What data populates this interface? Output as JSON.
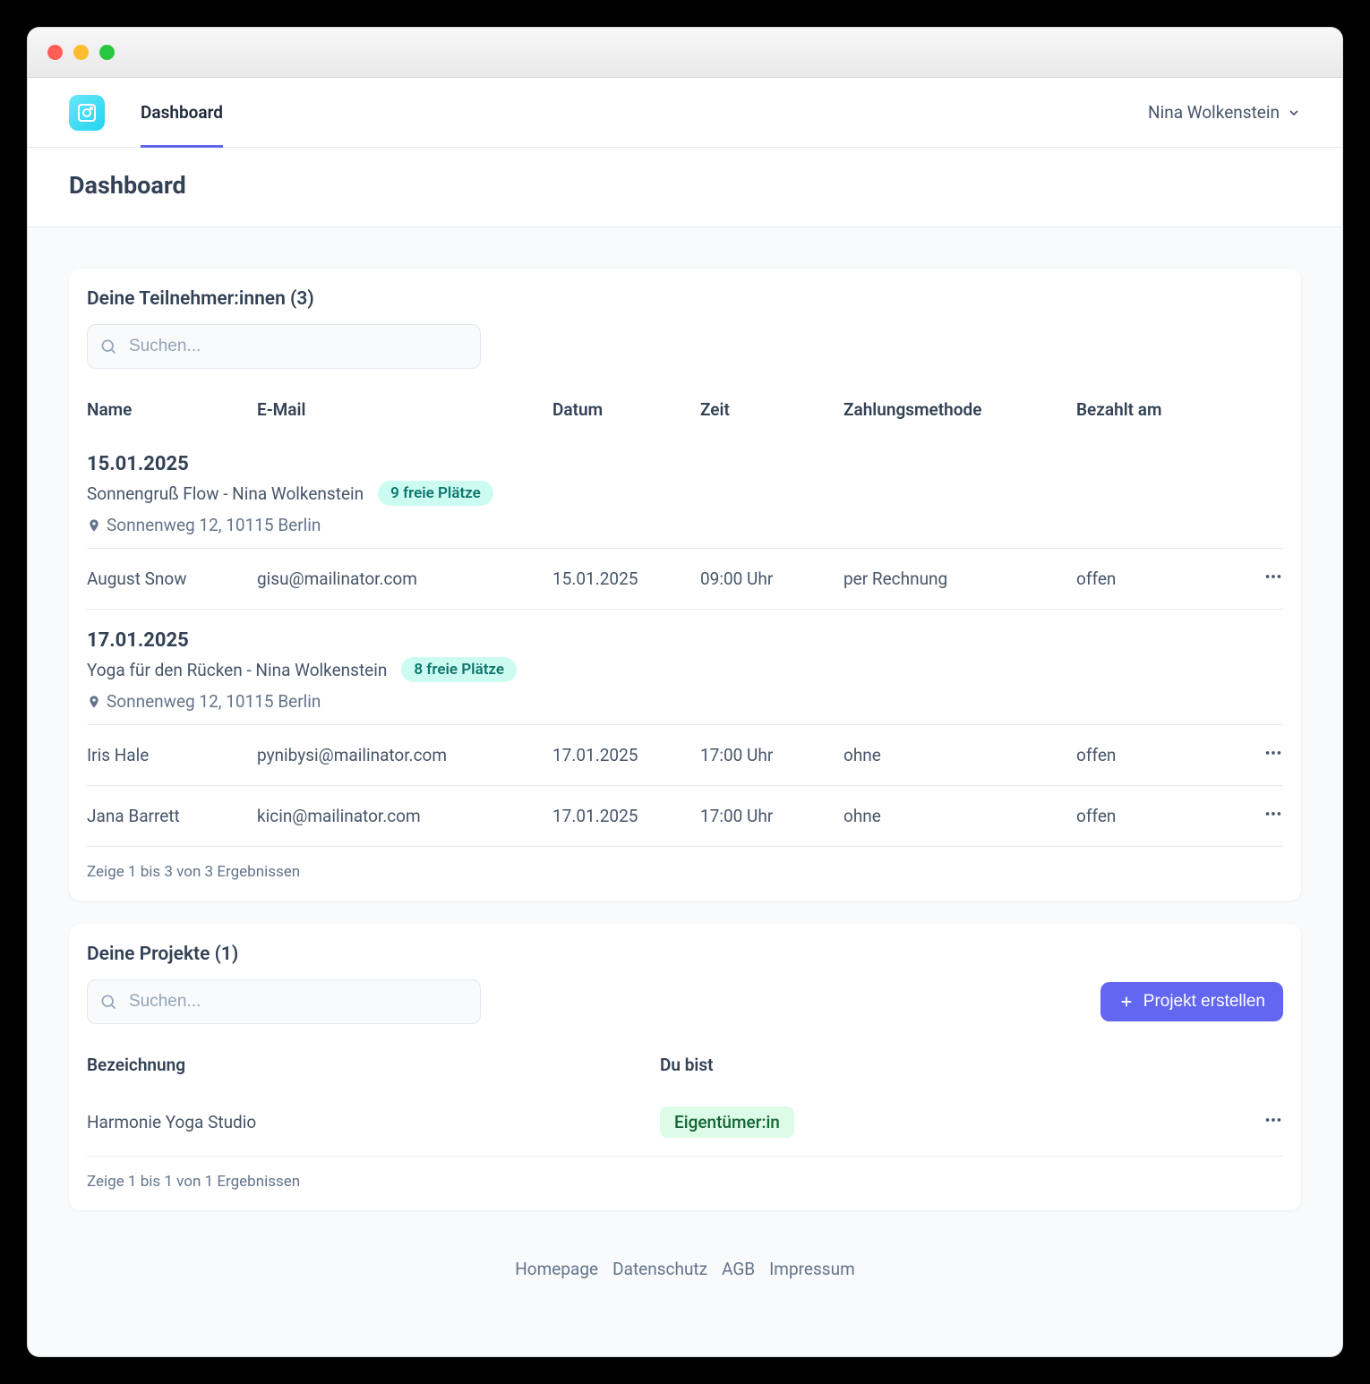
{
  "nav": {
    "tab": "Dashboard",
    "user": "Nina Wolkenstein"
  },
  "page_title": "Dashboard",
  "participants": {
    "title": "Deine Teilnehmer:innen (3)",
    "search_placeholder": "Suchen...",
    "columns": {
      "name": "Name",
      "email": "E-Mail",
      "date": "Datum",
      "time": "Zeit",
      "payment": "Zahlungsmethode",
      "paid_at": "Bezahlt am"
    },
    "groups": [
      {
        "date": "15.01.2025",
        "title": "Sonnengruß Flow - Nina Wolkenstein",
        "badge": "9 freie Plätze",
        "location": "Sonnenweg 12, 10115 Berlin",
        "rows": [
          {
            "name": "August Snow",
            "email": "gisu@mailinator.com",
            "date": "15.01.2025",
            "time": "09:00 Uhr",
            "payment": "per Rechnung",
            "paid_at": "offen"
          }
        ]
      },
      {
        "date": "17.01.2025",
        "title": "Yoga für den Rücken - Nina Wolkenstein",
        "badge": "8 freie Plätze",
        "location": "Sonnenweg 12, 10115 Berlin",
        "rows": [
          {
            "name": "Iris Hale",
            "email": "pynibysi@mailinator.com",
            "date": "17.01.2025",
            "time": "17:00 Uhr",
            "payment": "ohne",
            "paid_at": "offen"
          },
          {
            "name": "Jana Barrett",
            "email": "kicin@mailinator.com",
            "date": "17.01.2025",
            "time": "17:00 Uhr",
            "payment": "ohne",
            "paid_at": "offen"
          }
        ]
      }
    ],
    "result_text": "Zeige 1 bis 3 von 3 Ergebnissen"
  },
  "projects": {
    "title": "Deine Projekte (1)",
    "search_placeholder": "Suchen...",
    "create_label": "Projekt erstellen",
    "columns": {
      "name": "Bezeichnung",
      "role": "Du bist"
    },
    "rows": [
      {
        "name": "Harmonie Yoga Studio",
        "role": "Eigentümer:in"
      }
    ],
    "result_text": "Zeige 1 bis 1 von 1 Ergebnissen"
  },
  "footer": {
    "homepage": "Homepage",
    "privacy": "Datenschutz",
    "terms": "AGB",
    "imprint": "Impressum"
  }
}
